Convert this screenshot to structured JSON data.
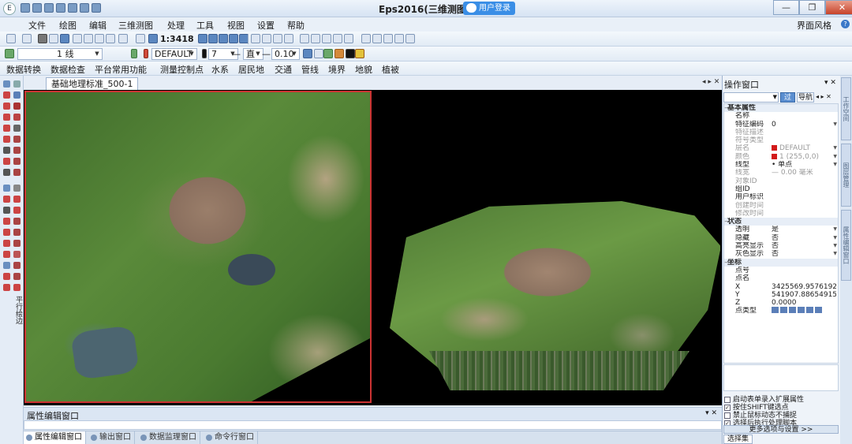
{
  "window": {
    "title": "Eps2016(三维测图)",
    "login_badge": "用户登录",
    "minimize": "—",
    "restore": "❐",
    "close": "✕"
  },
  "menu": [
    "文件",
    "绘图",
    "编辑",
    "三维测图",
    "处理",
    "工具",
    "视图",
    "设置",
    "帮助"
  ],
  "theme_label": "界面风格",
  "toolbar1": {
    "scale": "1:3418"
  },
  "toolbar2": {
    "line_combo": "1 线",
    "layer_combo": "DEFAULT",
    "color_combo": "7",
    "linetype_combo": "直",
    "linewidth_combo": "0.10"
  },
  "toolbar3": [
    "数据转换",
    "数据检查",
    "平台常用功能",
    "测量控制点",
    "水系",
    "居民地",
    "交通",
    "管线",
    "境界",
    "地貌",
    "植被"
  ],
  "left_vertical_label": "平行绘边",
  "document": {
    "tab": "基础地理标准_500-1"
  },
  "attr_panel": {
    "title": "属性编辑窗口",
    "tabs": [
      "属性编辑窗口",
      "输出窗口",
      "数据监理窗口",
      "命令行窗口"
    ]
  },
  "ops_panel": {
    "title": "操作窗口",
    "filter_btn": "过滤",
    "nav_btn": "导航",
    "rows": [
      {
        "type": "group",
        "key": "基本属性"
      },
      {
        "key": "名称",
        "value": ""
      },
      {
        "key": "特征编码",
        "value": "0"
      },
      {
        "key": "特征描述",
        "value": "",
        "dim": true
      },
      {
        "key": "符号类型",
        "value": "",
        "dim": true
      },
      {
        "key": "层名",
        "value": "DEFAULT",
        "dim": true,
        "swatch": true
      },
      {
        "key": "颜色",
        "value": "1 (255,0,0)",
        "dim": true,
        "swatch": true
      },
      {
        "key": "线型",
        "value": "• 单点"
      },
      {
        "key": "线宽",
        "value": "— 0.00 毫米",
        "dim": true
      },
      {
        "key": "对象ID",
        "value": "",
        "dim": true
      },
      {
        "key": "组ID",
        "value": ""
      },
      {
        "key": "用户标识",
        "value": ""
      },
      {
        "key": "创建时间",
        "value": "",
        "dim": true
      },
      {
        "key": "修改时间",
        "value": "",
        "dim": true
      },
      {
        "type": "group",
        "key": "状态"
      },
      {
        "key": "透明",
        "value": "是"
      },
      {
        "key": "隐藏",
        "value": "否"
      },
      {
        "key": "高亮显示",
        "value": "否"
      },
      {
        "key": "灰色显示",
        "value": "否"
      },
      {
        "type": "group",
        "key": "坐标"
      },
      {
        "key": "点号",
        "value": ""
      },
      {
        "key": "点名",
        "value": ""
      },
      {
        "key": "X",
        "value": "3425569.9576192..."
      },
      {
        "key": "Y",
        "value": "541907.88654915..."
      },
      {
        "key": "Z",
        "value": "0.0000"
      },
      {
        "key": "点类型",
        "value": ""
      }
    ],
    "checkboxes": [
      {
        "label": "启动表单录入扩展属性",
        "checked": false
      },
      {
        "label": "按住SHIFT键选点",
        "checked": true
      },
      {
        "label": "禁止鼠标动态不捕捉",
        "checked": false
      },
      {
        "label": "选择后执行处理脚本",
        "checked": true
      }
    ],
    "more_options": "更多选项与设置  >>",
    "bottom_tab": "选择集"
  },
  "right_vtabs": [
    "工作空间",
    "图层管理",
    "属性编辑窗口"
  ]
}
